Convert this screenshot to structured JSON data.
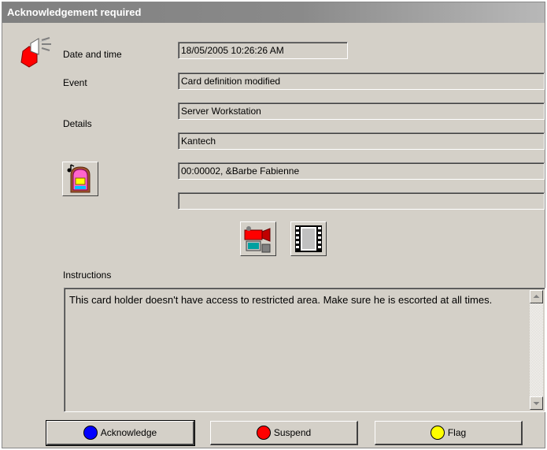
{
  "window": {
    "title": "Acknowledgement required"
  },
  "labels": {
    "date_time": "Date and time",
    "event": "Event",
    "details": "Details",
    "instructions": "Instructions"
  },
  "fields": {
    "date_time": "18/05/2005 10:26:26 AM",
    "event": "Card definition modified",
    "details_1": "Server Workstation",
    "details_2": "Kantech",
    "card_holder": "00:00002, &Barbe Fabienne",
    "extra": ""
  },
  "instructions_text": "This card holder doesn't have access to restricted area. Make sure he is escorted at all times.",
  "buttons": {
    "acknowledge": {
      "label": "Acknowledge",
      "color": "#0000ff"
    },
    "suspend": {
      "label": "Suspend",
      "color": "#ff0000"
    },
    "flag": {
      "label": "Flag",
      "color": "#ffff00"
    }
  },
  "icons": [
    "alarm-siren-icon",
    "jukebox-sound-icon",
    "video-camera-icon",
    "film-strip-icon"
  ]
}
